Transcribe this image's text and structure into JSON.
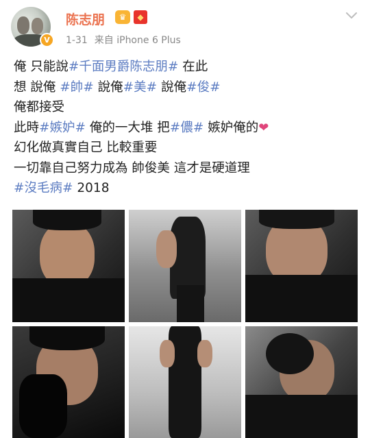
{
  "post": {
    "author": "陈志朋",
    "time": "1-31",
    "source": "来自 iPhone 6 Plus",
    "lines": [
      [
        {
          "t": "俺 只能說"
        },
        {
          "t": "#千面男爵陈志朋#",
          "tag": true
        },
        {
          "t": " 在此"
        }
      ],
      [
        {
          "t": "想 說俺 "
        },
        {
          "t": "#帥#",
          "tag": true
        },
        {
          "t": "  說俺"
        },
        {
          "t": "#美#",
          "tag": true
        },
        {
          "t": "  說俺"
        },
        {
          "t": "#俊#",
          "tag": true
        }
      ],
      [
        {
          "t": "俺都接受"
        }
      ],
      [
        {
          "t": "此時"
        },
        {
          "t": "#嫉妒#",
          "tag": true
        },
        {
          "t": " 俺的一大堆 把"
        },
        {
          "t": "#儂#",
          "tag": true
        },
        {
          "t": " 嫉妒俺的"
        },
        {
          "t": "❤",
          "heart": true
        }
      ],
      [
        {
          "t": "幻化做真實自己 比較重要"
        }
      ],
      [
        {
          "t": "一切靠自己努力成為 帥俊美 這才是硬道理"
        }
      ],
      [
        {
          "t": "#沒毛病#",
          "tag": true
        },
        {
          "t": " 2018"
        }
      ]
    ]
  },
  "icons": {
    "verified": "verified-v-icon",
    "crown": "crown-icon",
    "red_envelope": "red-envelope-icon",
    "more": "chevron-down-icon",
    "heart": "heart-icon"
  },
  "colors": {
    "username": "#eb7350",
    "hashtag": "#5d7dc2",
    "meta": "#888888",
    "heart": "#e0457b"
  },
  "photos": [
    "photo-1",
    "photo-2",
    "photo-3",
    "photo-4",
    "photo-5",
    "photo-6"
  ]
}
